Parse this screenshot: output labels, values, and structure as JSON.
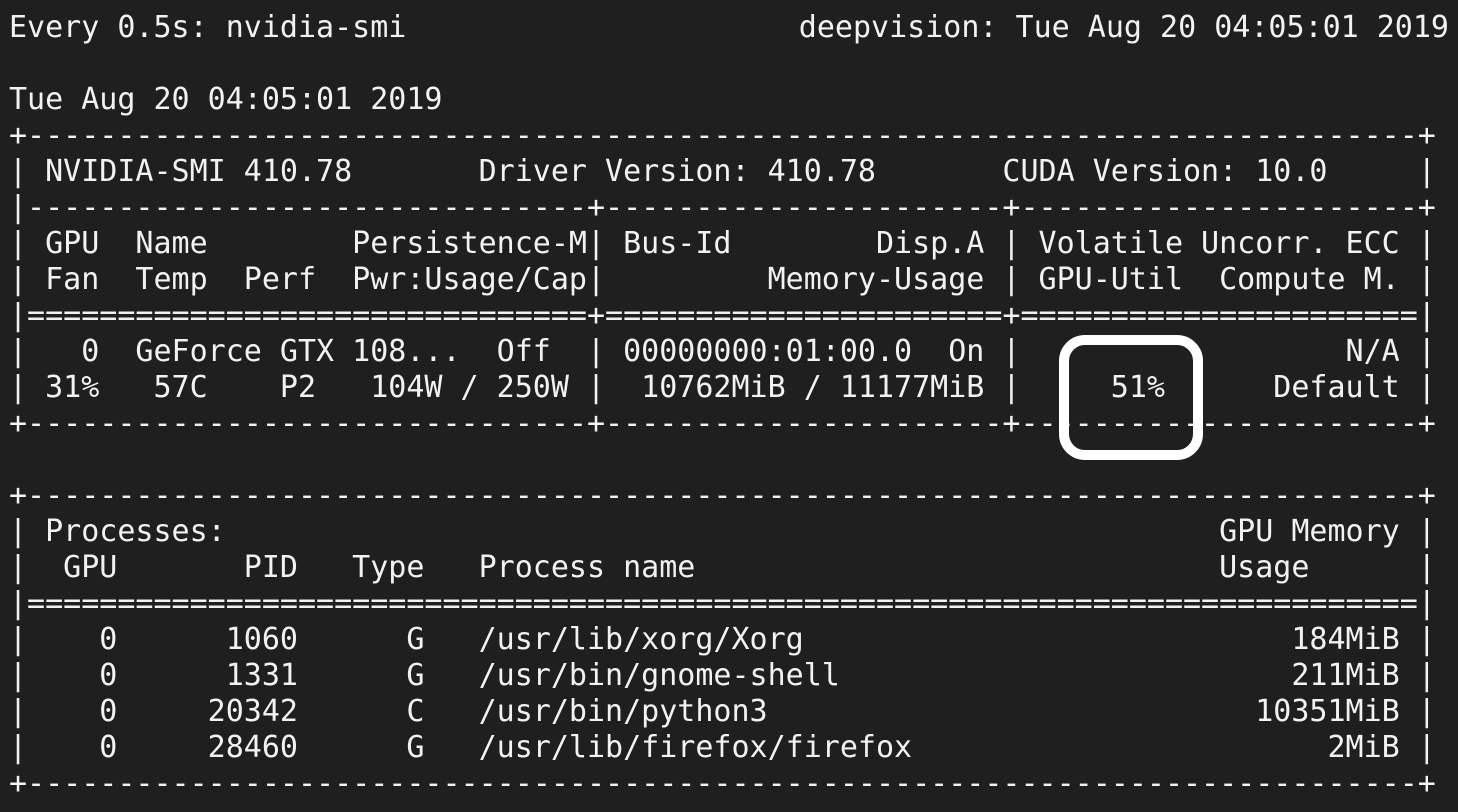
{
  "watch_header": {
    "command": "Every 0.5s: nvidia-smi",
    "host_time": "deepvision: Tue Aug 20 04:05:01 2019"
  },
  "timestamp": "Tue Aug 20 04:05:01 2019",
  "gpu_table": [
    "+-----------------------------------------------------------------------------+",
    "| NVIDIA-SMI 410.78       Driver Version: 410.78       CUDA Version: 10.0     |",
    "|-------------------------------+----------------------+----------------------+",
    "| GPU  Name        Persistence-M| Bus-Id        Disp.A | Volatile Uncorr. ECC |",
    "| Fan  Temp  Perf  Pwr:Usage/Cap|         Memory-Usage | GPU-Util  Compute M. |",
    "|===============================+======================+======================|",
    "|   0  GeForce GTX 108...  Off  | 00000000:01:00.0  On |                  N/A |",
    "| 31%   57C    P2   104W / 250W |  10762MiB / 11177MiB |     51%      Default |",
    "+-------------------------------+----------------------+----------------------+"
  ],
  "process_table": [
    "+-----------------------------------------------------------------------------+",
    "| Processes:                                                       GPU Memory |",
    "|  GPU       PID   Type   Process name                             Usage      |",
    "|=============================================================================|",
    "|    0      1060      G   /usr/lib/xorg/Xorg                           184MiB |",
    "|    0      1331      G   /usr/bin/gnome-shell                         211MiB |",
    "|    0     20342      C   /usr/bin/python3                           10351MiB |",
    "|    0     28460      G   /usr/lib/firefox/firefox                       2MiB |",
    "+-----------------------------------------------------------------------------+"
  ],
  "highlight": {
    "target": "51%",
    "color": "#ffffff"
  },
  "colors": {
    "background": "#1f1f1f",
    "text": "#f2f2f2"
  }
}
